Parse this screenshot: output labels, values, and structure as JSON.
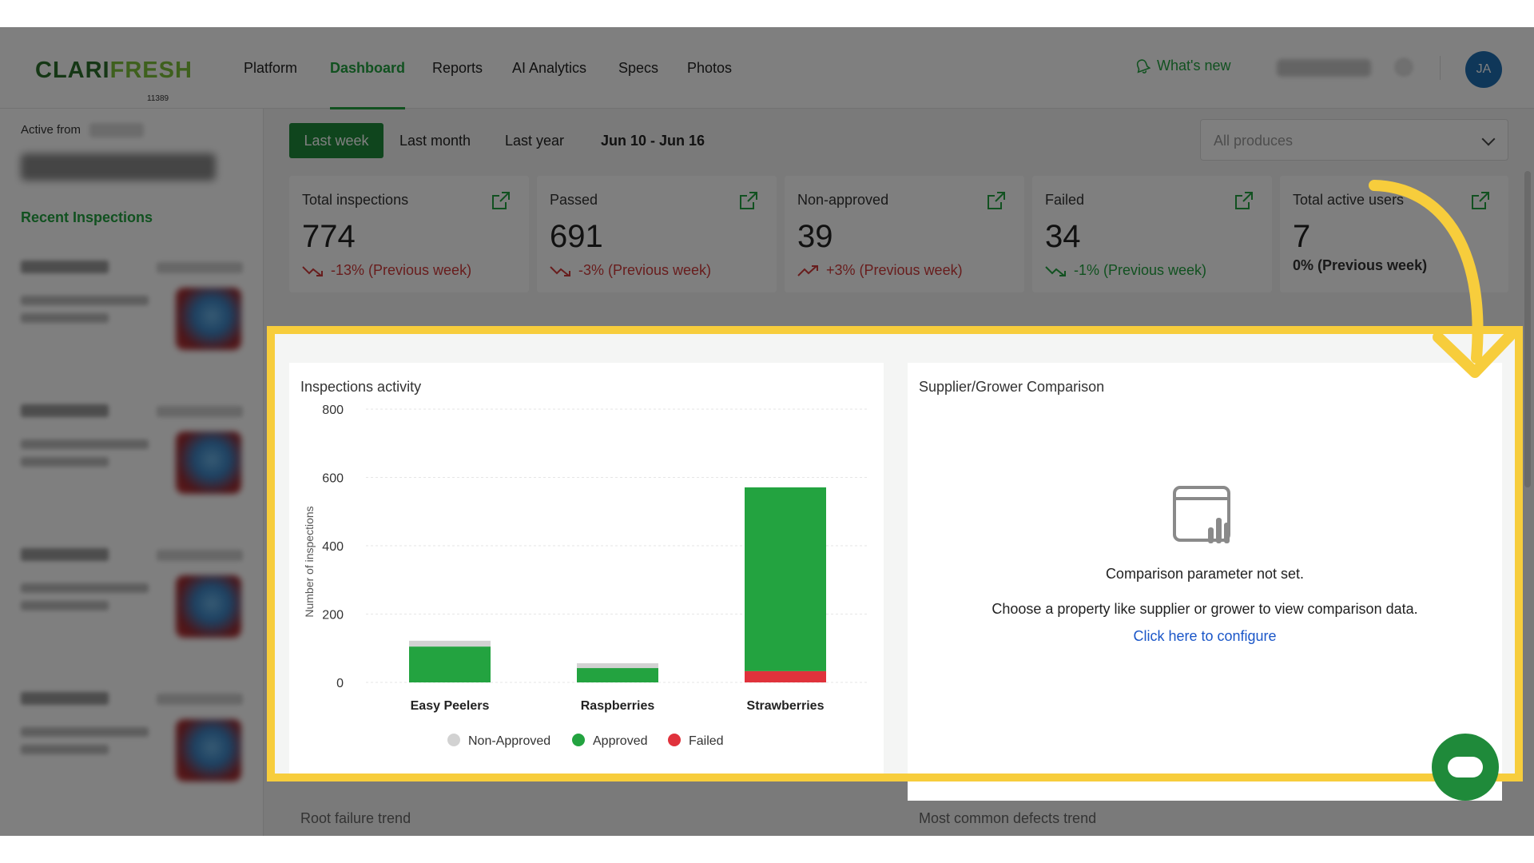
{
  "header": {
    "logo_a": "CLARI",
    "logo_b": "FRESH",
    "logo_code": "11389",
    "nav": [
      "Platform",
      "Dashboard",
      "Reports",
      "AI Analytics",
      "Specs",
      "Photos"
    ],
    "active_nav": "Dashboard",
    "whats_new": "What's new",
    "avatar_initials": "JA"
  },
  "sidebar": {
    "active_from": "Active from",
    "recent_title": "Recent Inspections"
  },
  "filters": {
    "last_week": "Last week",
    "last_month": "Last month",
    "last_year": "Last year",
    "range": "Jun 10 - Jun 16",
    "produce_placeholder": "All produces"
  },
  "stats": [
    {
      "title": "Total inspections",
      "value": "774",
      "trend": "-13% (Previous week)",
      "direction": "down",
      "color": "red"
    },
    {
      "title": "Passed",
      "value": "691",
      "trend": "-3% (Previous week)",
      "direction": "down",
      "color": "red"
    },
    {
      "title": "Non-approved",
      "value": "39",
      "trend": "+3% (Previous week)",
      "direction": "up",
      "color": "red"
    },
    {
      "title": "Failed",
      "value": "34",
      "trend": "-1% (Previous week)",
      "direction": "down",
      "color": "green"
    },
    {
      "title": "Total active users",
      "value": "7",
      "trend": "0% (Previous week)",
      "direction": "flat",
      "color": "neutral"
    }
  ],
  "chart_panel": {
    "title": "Inspections activity"
  },
  "chart_data": {
    "type": "bar",
    "stacked": true,
    "categories": [
      "Easy Peelers",
      "Raspberries",
      "Strawberries"
    ],
    "series": [
      {
        "name": "Failed",
        "values": [
          0,
          0,
          33
        ],
        "color": "#e0323c"
      },
      {
        "name": "Approved",
        "values": [
          105,
          42,
          538
        ],
        "color": "#23a340"
      },
      {
        "name": "Non-Approved",
        "values": [
          17,
          14,
          0
        ],
        "color": "#d2d2d2"
      }
    ],
    "legend_order": [
      "Non-Approved",
      "Approved",
      "Failed"
    ],
    "ylabel": "Number of inspections",
    "xlabel": "",
    "ylim": [
      0,
      800
    ],
    "yticks": [
      0,
      200,
      400,
      600,
      800
    ],
    "grid": true,
    "legend": "bottom"
  },
  "compare_panel": {
    "title": "Supplier/Grower Comparison",
    "message": "Comparison parameter not set.",
    "hint": "Choose a property like supplier or grower to view comparison data.",
    "link": "Click here to configure"
  },
  "below": {
    "left_title": "Root failure trend",
    "right_title": "Most common defects trend"
  },
  "colors": {
    "brand_green": "#23a340",
    "highlight": "#f7cd3c",
    "link": "#1a56c8"
  }
}
